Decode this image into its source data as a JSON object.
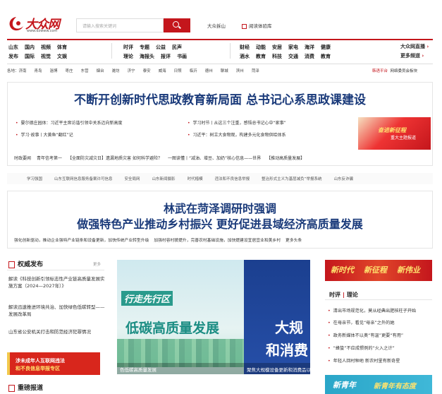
{
  "logo": {
    "name": "大众网",
    "url": "www.dzwww.com"
  },
  "search": {
    "placeholder": "请输入搜索关键词"
  },
  "top_links": {
    "forum": "大众拆山",
    "reader": "阅读体验库"
  },
  "nav": {
    "group1": [
      [
        "山东",
        "国内",
        "视频",
        "体育"
      ],
      [
        "发布",
        "国际",
        "视觉",
        "文娱"
      ]
    ],
    "group2": [
      [
        "时评",
        "专题",
        "公益",
        "民声"
      ],
      [
        "理论",
        "海报头",
        "报评",
        "书画"
      ]
    ],
    "group3": [
      [
        "财经",
        "动能",
        "安居",
        "家电",
        "海洋",
        "健康"
      ],
      [
        "酒水",
        "教育",
        "科技",
        "交通",
        "消费",
        "教育"
      ]
    ],
    "right": [
      "大众网直播",
      "更多频道"
    ]
  },
  "cities": [
    "各地：济南",
    "青岛",
    "淄博",
    "枣庄",
    "东营",
    "烟台",
    "潍坊",
    "济宁",
    "泰安",
    "威海",
    "日照",
    "临沂",
    "德州",
    "聊城",
    "滨州",
    "菏泽"
  ],
  "cities_right": {
    "intl": "韩语平台",
    "gov": "网络委员会板块"
  },
  "headline1": "不断开创新时代思政教育新局面 总书记心系思政课建设",
  "news1_left": [
    "晏尔德庄园体：习近平主席访谐引领中关系迈向新高度",
    "学习·故事丨大黄鱼“翻红”记"
  ],
  "news1_mid": [
    "学习时节丨从这三个注重，感悟总书记心中“家事”",
    "习近平：树立大食物观，构建多元化食物供给体系"
  ],
  "banner1": {
    "line1": "奋进新征程",
    "line2": "重大主题报道"
  },
  "ticker": [
    "时政要闻",
    "青年信考第一",
    "【全面防灾减灾日】遗漏地质灾害 如何科学避险？",
    "一图读懂丨“减油、增豆、加奶”核心信息——世界",
    "【推动高质量发展】"
  ],
  "topics": [
    "学习强国",
    "山东互联网信息服务备案许可信息",
    "安全局网",
    "山东新闻摄影",
    "时代楷模",
    "违法和不良信息举报",
    "整治形式主义为基层减负”举报系统",
    "山东反诈骗"
  ],
  "headline2": {
    "line1": "林武在菏泽调研时强调",
    "line2": "做强特色产业推动乡村振兴 更好促进县域经济高质量发展"
  },
  "sub2": [
    "强化创新驱动，推动企业强特产业链条和设备更新，加快传统产业转型升级",
    "加强村容村貌提升，完善农村基础设施，加快提建设宜居宜业和美乡村",
    "更多头条"
  ],
  "left_section": {
    "title": "权威发布",
    "more": "更多",
    "items": [
      "解读《科技创新引领标志性产业链高质量发展实施方案（2024—2027年）》",
      "解读迅速推进环境共治、加快绿色低碳转型——发展改革局",
      "山东省公安机关打击和防范经济犯罪情况"
    ],
    "banner": {
      "line1": "涉未成年人互联网违法",
      "line2": "和不良信息举报专区"
    },
    "title2": "重磅报道"
  },
  "carousel": {
    "left": {
      "tag": "行走先行区",
      "headline": "低碳高质量发展",
      "caption": "色低碳高质量发展"
    },
    "right": {
      "big1": "大规",
      "big2": "和消费",
      "caption": "聚焦大规模设备更新和消费品以旧换新"
    }
  },
  "right_section": {
    "banner": [
      "新时代",
      "新征程",
      "新伟业"
    ],
    "tabs": [
      "时评",
      "理论"
    ],
    "items": [
      "清出市场规范化，莫从经典出肥核柱子开始",
      "在母亲节，看见“母亲”之外的她",
      "政务新媒体不以奥“有温”更要“有用”",
      "“蜂蛰”不应成惯例的“火入之计”",
      "年轻人回村种地 新农村里有新奇星"
    ],
    "banner2": {
      "line1": "新青年",
      "line2": "新青年有态度"
    }
  },
  "colors": {
    "brand": "#c4161c",
    "headline": "#1a3a7a"
  }
}
